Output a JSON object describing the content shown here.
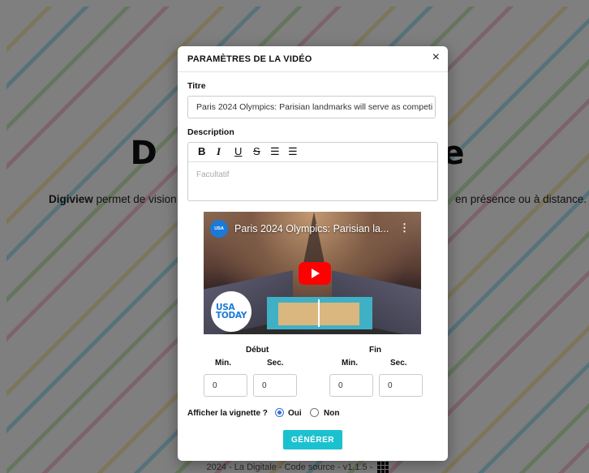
{
  "background": {
    "app_title": "Digiview",
    "app_title_left": "D",
    "app_title_right": "le",
    "description_bold": "Digiview",
    "description_left": "permet de vision",
    "description_right": "en présence ou à distance.",
    "footer": "2024 - La Digitale - Code source - v1.1.5 -",
    "colors": {
      "blue": "#48c4ec",
      "pink": "#f284a0",
      "green": "#8cd868",
      "yellow": "#f6d25a"
    }
  },
  "modal": {
    "title": "PARAMÈTRES DE LA VIDÉO",
    "close_icon": "×",
    "title_label": "Titre",
    "title_value": "Paris 2024 Olympics: Parisian landmarks will serve as competi",
    "description_label": "Description",
    "description_placeholder": "Facultatif",
    "toolbar": {
      "bold": "B",
      "italic": "I",
      "underline": "U",
      "strike": "S",
      "ordered_list": "☰",
      "bullet_list": "☰"
    },
    "video": {
      "channel": "USA TODAY",
      "channel_logo_line1": "USA",
      "channel_logo_line2": "TODAY",
      "title": "Paris 2024 Olympics: Parisian la...",
      "menu": "⋮"
    },
    "start_label": "Début",
    "end_label": "Fin",
    "min_label": "Min.",
    "sec_label": "Sec.",
    "start_min": "0",
    "start_sec": "0",
    "end_min": "0",
    "end_sec": "0",
    "thumbnail_question": "Afficher la vignette ?",
    "option_yes": "Oui",
    "option_no": "Non",
    "selected_option": "Oui",
    "generate_button": "GÉNÉRER",
    "accent_color": "#1cc1cf"
  }
}
